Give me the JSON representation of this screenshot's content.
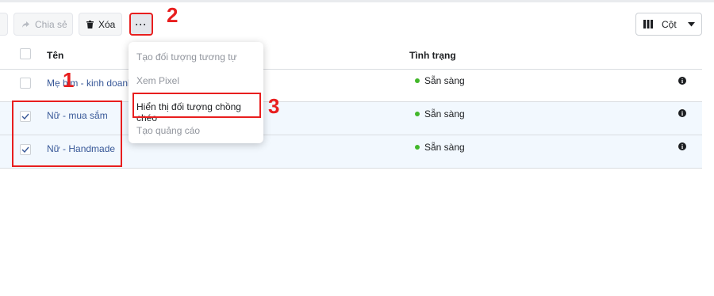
{
  "toolbar": {
    "share_label": "Chia sẻ",
    "delete_label": "Xóa",
    "more_label": "···",
    "columns_label": "Cột"
  },
  "table": {
    "headers": {
      "name": "Tên",
      "status": "Tình trạng"
    },
    "rows": [
      {
        "name": "Mẹ bỉm - kinh doanh",
        "status": "Sẵn sàng",
        "checked": false
      },
      {
        "name": "Nữ - mua sắm",
        "status": "Sẵn sàng",
        "checked": true
      },
      {
        "name": "Nữ - Handmade",
        "status": "Sẵn sàng",
        "checked": true
      }
    ]
  },
  "more_menu": {
    "items": [
      {
        "label": "Tạo đối tượng tương tự",
        "enabled": false
      },
      {
        "label": "Xem Pixel",
        "enabled": false
      },
      {
        "label": "Hiển thị đối tượng chồng chéo",
        "enabled": true
      },
      {
        "label": "Tạo quảng cáo",
        "enabled": false
      }
    ]
  },
  "annotations": {
    "step1": "1",
    "step2": "2",
    "step3": "3"
  },
  "colors": {
    "annotation_red": "#e81e1e",
    "link_blue": "#385898",
    "status_green": "#42b72a",
    "selected_row": "#f2f8fe"
  },
  "icons": [
    "share-icon",
    "trash-icon",
    "more-icon",
    "columns-icon",
    "caret-down-icon",
    "checkmark-icon",
    "info-icon",
    "status-dot-icon"
  ]
}
